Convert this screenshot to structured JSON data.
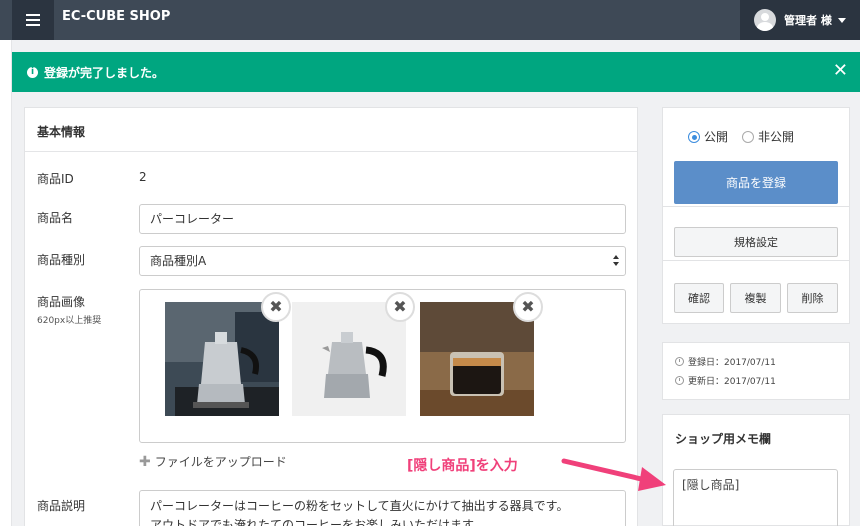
{
  "header": {
    "title": "EC-CUBE SHOP",
    "user": "管理者 様"
  },
  "alert": {
    "message": "登録が完了しました。",
    "close": "✕"
  },
  "basic": {
    "heading": "基本情報",
    "id_label": "商品ID",
    "id_value": "2",
    "name_label": "商品名",
    "name_value": "パーコレーター",
    "type_label": "商品種別",
    "type_value": "商品種別A",
    "image_label": "商品画像",
    "image_hint": "620px以上推奨",
    "upload": "ファイルをアップロード",
    "desc_label": "商品説明",
    "desc_line1": "パーコレーターはコーヒーの粉をセットして直火にかけて抽出する器具です。",
    "desc_line2": "アウトドアでも淹れたてのコーヒーをお楽しみいただけます。"
  },
  "publish": {
    "public": "公開",
    "private": "非公開",
    "register": "商品を登録"
  },
  "actions": {
    "spec": "規格設定",
    "confirm": "確認",
    "copy": "複製",
    "delete": "削除"
  },
  "dates": {
    "created": "登録日：2017/07/11",
    "updated": "更新日：2017/07/11"
  },
  "memo": {
    "title": "ショップ用メモ欄",
    "value": "[隠し商品]"
  },
  "annotation": {
    "text": "[隠し商品]を入力",
    "color": "#f0407a"
  },
  "colors": {
    "header": "#3e4956",
    "alert": "#00a680",
    "primary": "#5b8ec9"
  }
}
